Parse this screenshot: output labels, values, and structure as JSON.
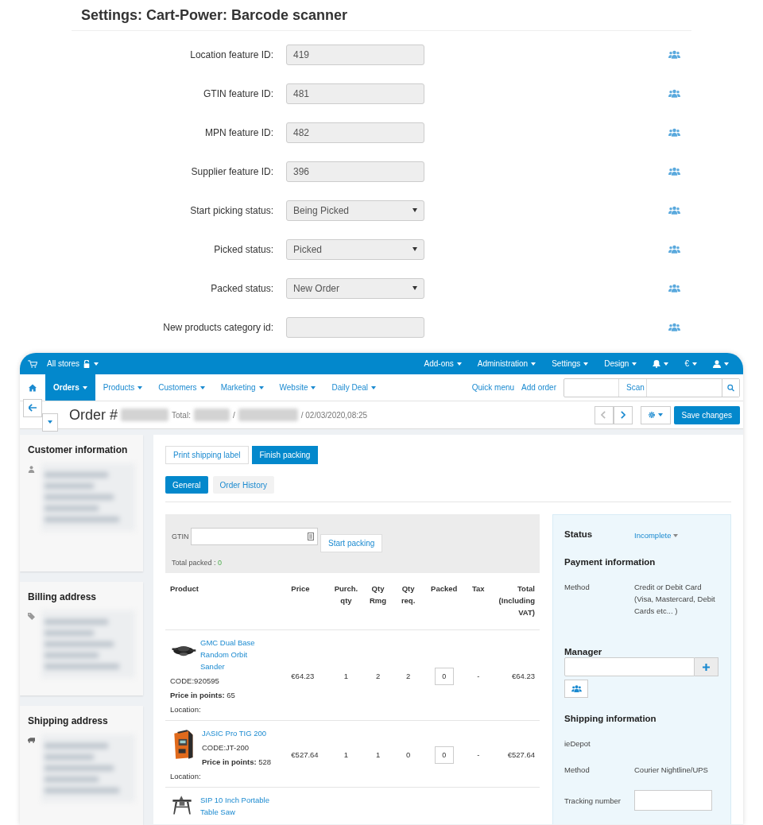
{
  "settings": {
    "title": "Settings: Cart-Power: Barcode scanner",
    "fields": [
      {
        "label": "Location feature ID:",
        "kind": "input",
        "value": "419"
      },
      {
        "label": "GTIN feature ID:",
        "kind": "input",
        "value": "481"
      },
      {
        "label": "MPN feature ID:",
        "kind": "input",
        "value": "482"
      },
      {
        "label": "Supplier feature ID:",
        "kind": "input",
        "value": "396"
      },
      {
        "label": "Start picking status:",
        "kind": "select",
        "value": "Being Picked"
      },
      {
        "label": "Picked status:",
        "kind": "select",
        "value": "Picked"
      },
      {
        "label": "Packed status:",
        "kind": "select",
        "value": "New Order"
      },
      {
        "label": "New products category id:",
        "kind": "input"
      }
    ]
  },
  "topbar": {
    "store": "All stores",
    "right": [
      "Add-ons",
      "Administration",
      "Settings",
      "Design"
    ],
    "currency": "€"
  },
  "nav": {
    "items": [
      {
        "label": "Orders",
        "selected": true
      },
      {
        "label": "Products",
        "selected": false
      },
      {
        "label": "Customers",
        "selected": false
      },
      {
        "label": "Marketing",
        "selected": false
      },
      {
        "label": "Website",
        "selected": false
      },
      {
        "label": "Daily Deal",
        "selected": false
      }
    ],
    "links": [
      "Quick menu",
      "Add order"
    ],
    "scan_label": "Scan"
  },
  "order": {
    "title": "Order #",
    "total_label": "Total:",
    "separator": "/",
    "date": "/ 02/03/2020,08:25",
    "save": "Save changes"
  },
  "sidebar": [
    {
      "title": "Customer information"
    },
    {
      "title": "Billing address"
    },
    {
      "title": "Shipping address"
    }
  ],
  "actions": [
    {
      "label": "Print shipping label",
      "primary": false
    },
    {
      "label": "Finish packing",
      "primary": true
    }
  ],
  "tabs": [
    {
      "label": "General",
      "selected": true
    },
    {
      "label": "Order History",
      "selected": false
    }
  ],
  "packing": {
    "gtin_label": "GTIN",
    "start": "Start packing",
    "total_label": "Total packed : ",
    "total": "0"
  },
  "table": {
    "columns": [
      "Product",
      "Price",
      "Purch. qty",
      "Qty Rmg",
      "Qty req.",
      "Packed",
      "Tax",
      "Total (Including VAT)"
    ],
    "rows": [
      {
        "name": "GMC Dual Base Random Orbit Sander",
        "code": "CODE:920595",
        "points_label": "Price in points:",
        "points": "65",
        "location": "Location:",
        "price": "€64.23",
        "purch": "1",
        "rmg": "2",
        "req": "2",
        "packed": "0",
        "tax": "-",
        "total": "€64.23"
      },
      {
        "name": "JASIC Pro TIG 200",
        "code": "CODE:JT-200",
        "points_label": "Price in points:",
        "points": "528",
        "location": "Location:",
        "price": "€527.64",
        "purch": "1",
        "rmg": "1",
        "req": "0",
        "packed": "0",
        "tax": "-",
        "total": "€527.64"
      },
      {
        "name": "SIP 10 Inch Portable Table Saw"
      }
    ]
  },
  "info": {
    "status_label": "Status",
    "status": "Incomplete",
    "payment_title": "Payment information",
    "method_label": "Method",
    "payment_method": "Credit or Debit Card (Visa, Mastercard, Debit Cards etc... )",
    "manager_title": "Manager",
    "shipping_title": "Shipping information",
    "carrier": "ieDepot",
    "ship_method_label": "Method",
    "ship_method": "Courier Nightline/UPS",
    "tracking_label": "Tracking number"
  }
}
